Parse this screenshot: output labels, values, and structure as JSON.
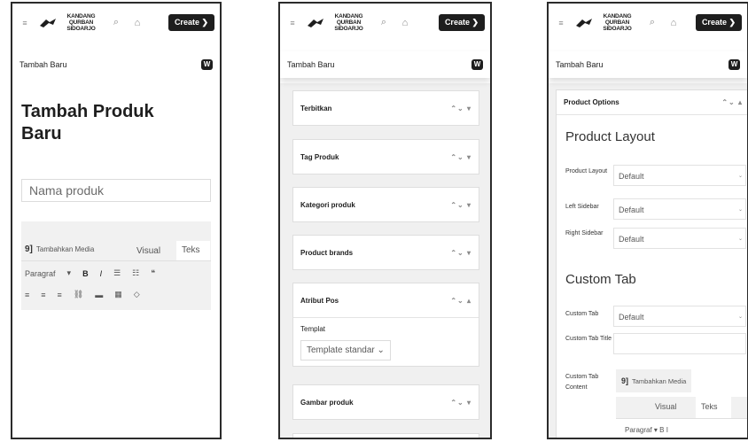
{
  "common": {
    "logo_line1": "KANDANG QURBAN",
    "logo_line2": "SIDOARJO",
    "create_label": "Create ❯",
    "subbar_label": "Tambah Baru",
    "w_badge": "W",
    "hamburger": "≡",
    "search_icon": "⌕",
    "home_icon": "⌂"
  },
  "panel1": {
    "title": "Tambah Produk Baru",
    "name_placeholder": "Nama produk",
    "add_media": "Tambahkan Media",
    "media_icon": "9]",
    "tab_visual": "Visual",
    "tab_teks": "Teks",
    "toolbar_row1": [
      "Paragraf",
      "▾",
      "B",
      "I",
      "☰",
      "☷",
      "❝"
    ],
    "toolbar_row2": [
      "≡",
      "≡",
      "≡",
      "⛓",
      "▬",
      "▦",
      "◇"
    ]
  },
  "panel2": {
    "boxes": [
      {
        "title": "Terbitkan",
        "controls": "⌃⌄ ▾"
      },
      {
        "title": "Tag Produk",
        "controls": "⌃⌄ ▾"
      },
      {
        "title": "Kategori produk",
        "controls": "⌃⌄ ▾"
      },
      {
        "title": "Product brands",
        "controls": "⌃⌄ ▾"
      },
      {
        "title": "Atribut Pos",
        "controls": "⌃⌄ ▴"
      },
      {
        "title": "Gambar produk",
        "controls": "⌃⌄ ▾"
      }
    ],
    "template_label": "Templat",
    "template_value": "Template standar ⌄"
  },
  "panel3": {
    "box_title": "Product Options",
    "box_controls": "⌃⌄ ▴",
    "section1": "Product Layout",
    "section2": "Custom Tab",
    "fields": {
      "product_layout_label": "Product Layout",
      "product_layout_value": "Default",
      "left_sidebar_label": "Left Sidebar",
      "left_sidebar_value": "Default",
      "right_sidebar_label": "Right Sidebar",
      "right_sidebar_value": "Default",
      "custom_tab_label": "Custom Tab",
      "custom_tab_value": "Default",
      "custom_tab_title_label": "Custom Tab Title",
      "custom_tab_content_label": "Custom Tab Content"
    },
    "caret": "⌄",
    "add_media": "Tambahkan Media",
    "media_icon": "9]",
    "tab_visual": "Visual",
    "tab_teks": "Teks",
    "toolbar_row": "Paragraf  ▾  B  I"
  }
}
